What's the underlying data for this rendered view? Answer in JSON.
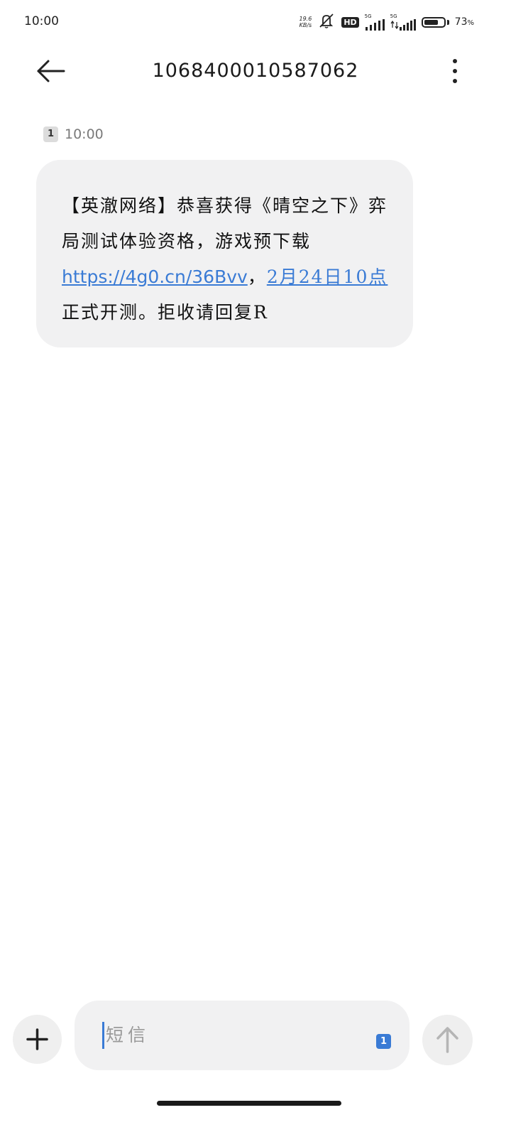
{
  "status_bar": {
    "time": "10:00",
    "net_speed_value": "19.6",
    "net_speed_unit": "KB/s",
    "hd_label": "HD",
    "signal1_label": "5G",
    "signal2_label": "5G",
    "battery_percent": "73",
    "battery_level": 0.73,
    "icons": [
      "mute-vibrate-icon",
      "hd-voice-icon",
      "signal-icon",
      "signal-icon",
      "battery-icon"
    ]
  },
  "header": {
    "title": "1068400010587062",
    "back_icon": "back-arrow-icon",
    "menu_icon": "more-vertical-icon"
  },
  "message": {
    "sim_slot": "1",
    "time": "10:00",
    "text_before_link": "【英澈网络】恭喜获得《晴空之下》弈局测试体验资格，游戏预下载",
    "link": "https://4g0.cn/36Bvv",
    "text_after_link": "，",
    "date_link": "2月24日10点",
    "text_end": "正式开测。拒收请回复R"
  },
  "composer": {
    "placeholder": "短信",
    "sim_slot": "1",
    "add_icon": "plus-icon",
    "send_icon": "arrow-up-icon"
  },
  "colors": {
    "accent": "#3a7bd5",
    "bubble_bg": "#f1f1f2",
    "text": "#111111"
  }
}
